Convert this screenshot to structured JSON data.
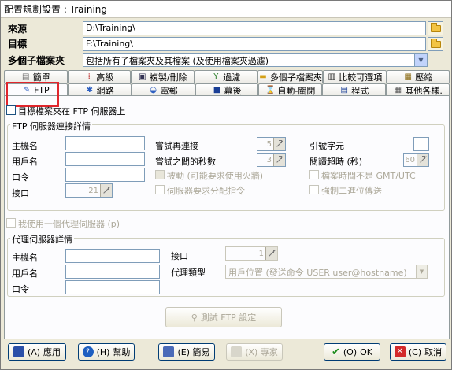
{
  "window": {
    "title": "配置規劃設置 : Training"
  },
  "paths": {
    "source_label": "來源",
    "source_value": "D:\\Training\\",
    "target_label": "目標",
    "target_value": "F:\\Training\\",
    "subfolder_label": "多個子檔案夾",
    "subfolder_value": "包括所有子檔案夾及其檔案 (及使用檔案夾過濾)"
  },
  "tabs_row1": [
    {
      "label": "簡單",
      "icon": "simple-icon"
    },
    {
      "label": "高級",
      "icon": "advanced-icon"
    },
    {
      "label": "複製/刪除",
      "icon": "copy-delete-icon"
    },
    {
      "label": "過濾",
      "icon": "filter-icon"
    },
    {
      "label": "多個子檔案夾",
      "icon": "subfolders-icon"
    },
    {
      "label": "比較可選項",
      "icon": "compare-icon"
    },
    {
      "label": "壓縮",
      "icon": "zip-icon"
    }
  ],
  "tabs_row2": [
    {
      "label": "FTP",
      "icon": "ftp-icon"
    },
    {
      "label": "網路",
      "icon": "network-icon"
    },
    {
      "label": "電郵",
      "icon": "email-icon"
    },
    {
      "label": "幕後",
      "icon": "background-icon"
    },
    {
      "label": "自動-關閉",
      "icon": "auto-close-icon"
    },
    {
      "label": "程式",
      "icon": "programs-icon"
    },
    {
      "label": "其他各樣.",
      "icon": "misc-icon"
    }
  ],
  "ftp": {
    "target_on_ftp_label": "目標檔案夾在 FTP 伺服器上",
    "connection_group_title": "FTP 伺服器連接詳情",
    "host_label": "主機名",
    "user_label": "用戶名",
    "password_label": "口令",
    "port_label": "接口",
    "port_value": "21",
    "retry_label": "嘗試再連接",
    "retry_value": "5",
    "retry_delay_label": "嘗試之間的秒數",
    "retry_delay_value": "3",
    "passive_label": "被動 (可能要求使用火牆)",
    "server_assign_label": "伺服器要求分配指令",
    "quote_char_label": "引號字元",
    "read_timeout_label": "閱讀超時 (秒)",
    "read_timeout_value": "60",
    "gmt_label": "檔案時間不是 GMT/UTC",
    "binary_label": "強制二進位傳送",
    "use_proxy_label": "我使用一個代理伺服器 (p)",
    "proxy_group_title": "代理伺服器詳情",
    "proxy_host_label": "主機名",
    "proxy_user_label": "用戶名",
    "proxy_password_label": "口令",
    "proxy_port_label": "接口",
    "proxy_port_value": "1",
    "proxy_type_label": "代理類型",
    "proxy_type_value": "用戶位置 (發送命令 USER user@hostname)",
    "test_button": "測試 FTP 設定"
  },
  "footer": {
    "apply": "應用",
    "help": "幫助",
    "apply_mn": "(A)",
    "help_mn": "(H)",
    "simple": "(E) 簡易",
    "expert": "(X) 專家",
    "ok": "OK",
    "ok_mn": "(O)",
    "cancel": "取消",
    "cancel_mn": "(C)"
  }
}
